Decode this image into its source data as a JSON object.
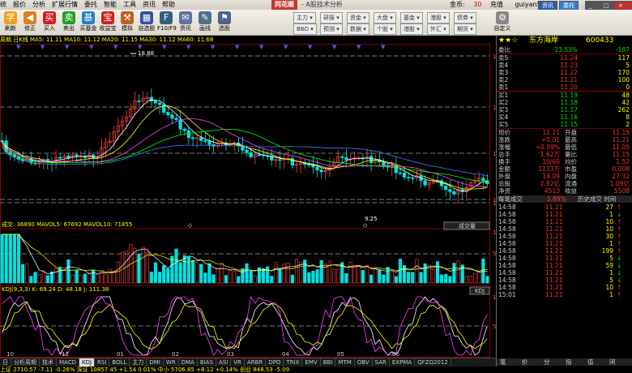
{
  "menu": {
    "items": [
      "统",
      "报价",
      "分析",
      "扩展行情",
      "委托",
      "智能",
      "工具",
      "资讯",
      "帮助"
    ],
    "brand": "同花顺",
    "subtitle": "- A股技术分析",
    "coins_label": "金币:",
    "coins_value": "30",
    "recharge": "充值",
    "user": "guiyan522",
    "btn_news": "资讯",
    "btn_trade": "委托"
  },
  "toolbar": {
    "buttons": [
      {
        "label": "刷新",
        "icon": "refresh-icon",
        "glyph": "学",
        "color": "#f0a020"
      },
      {
        "label": "修正",
        "icon": "back-icon",
        "glyph": "◀",
        "color": "#e08020"
      },
      {
        "label": "买入",
        "icon": "buy-icon",
        "glyph": "买",
        "color": "#d02020"
      },
      {
        "label": "卖出",
        "icon": "sell-icon",
        "glyph": "卖",
        "color": "#20a020"
      },
      {
        "label": "买基金",
        "icon": "fund-icon",
        "glyph": "基",
        "color": "#2080d0"
      },
      {
        "label": "收益宝",
        "icon": "profit-icon",
        "glyph": "宝",
        "color": "#d02020"
      },
      {
        "label": "模拟",
        "icon": "hammer-icon",
        "glyph": "⚒",
        "color": "#c06020"
      },
      {
        "label": "自选股",
        "icon": "watchlist-icon",
        "glyph": "▦",
        "color": "#3050a0"
      },
      {
        "label": "F10/F9",
        "icon": "f10-icon",
        "glyph": "F",
        "color": "#306080"
      },
      {
        "label": "资讯",
        "icon": "news-icon",
        "glyph": "✉",
        "color": "#6070a0"
      },
      {
        "label": "画线",
        "icon": "draw-icon",
        "glyph": "✎",
        "color": "#507090"
      },
      {
        "label": "选股",
        "icon": "stockpick-icon",
        "glyph": "⚑",
        "color": "#506090"
      }
    ],
    "pills": [
      {
        "label": "主力",
        "sub": "BBD"
      },
      {
        "label": "研报",
        "sub": "预测"
      },
      {
        "label": "资金",
        "sub": "数据"
      },
      {
        "label": "大盘",
        "sub": "个股"
      },
      {
        "label": "基金",
        "sub": "港股"
      },
      {
        "label": "港股",
        "sub": "外汇"
      },
      {
        "label": "债券",
        "sub": "期货"
      }
    ],
    "custom_label": "自定义"
  },
  "chart": {
    "info_line": "周期  日K线  MA5: 11.11  MA10: 11.12  MA20: 11.15  MA30: 11.12  MA60: 11.68",
    "vol_info": "成交: 36890  MAVOL5: 67692  MAVOL10: 71855",
    "kdj_info": "KDJ(9,3,3)  K: 69.24  D: 48.18  J: 111.38",
    "right_axis": [
      "18.88",
      "17.70",
      "14.62",
      "12.24",
      "10.75"
    ],
    "vol_axis": [
      "113990",
      "57634",
      "0"
    ],
    "kdj_axis": [
      "100.00",
      "50.00",
      "0.00"
    ],
    "high_label": "18.88",
    "low_label": "9.25",
    "vol_btn": "成交量",
    "kdj_btn": "KDJ",
    "x_ticks": [
      "10",
      "12",
      "01",
      "02",
      "03",
      "04",
      "05",
      "06"
    ]
  },
  "tabs": {
    "items": [
      "日",
      "分析周期",
      "技术",
      "MACD",
      "KDJ",
      "RSI",
      "BOLL",
      "主力",
      "DMI",
      "WR",
      "DMA",
      "BIAS",
      "ASI",
      "VR",
      "ARBR",
      "DPO",
      "TRIX",
      "EMV",
      "BBI",
      "MTM",
      "OBV",
      "SAR",
      "EXPMA",
      "QFZQ2012"
    ],
    "active_index": 4
  },
  "status": "上证 2710.57  -7.11  -0.26%   深证 10857.45  +1.54  0.01%   中小 5706.85  +8.12  +0.14%   创业 848.53  -5.09",
  "quote": {
    "rating": "★★☆",
    "name": "东方海岸",
    "code": "600433",
    "weibi_label": "委比",
    "weibi": "-23.53%",
    "weicha_label": "委差",
    "weicha": "-187",
    "sell": [
      {
        "lvl": "5",
        "price": "11.24",
        "vol": "117"
      },
      {
        "lvl": "4",
        "price": "11.23",
        "vol": "5"
      },
      {
        "lvl": "3",
        "price": "11.22",
        "vol": "170"
      },
      {
        "lvl": "2",
        "price": "11.21",
        "vol": "100"
      },
      {
        "lvl": "1",
        "price": "11.20",
        "vol": "0"
      }
    ],
    "buy": [
      {
        "lvl": "1",
        "price": "11.19",
        "vol": "48"
      },
      {
        "lvl": "2",
        "price": "11.18",
        "vol": "42"
      },
      {
        "lvl": "3",
        "price": "11.17",
        "vol": "262"
      },
      {
        "lvl": "4",
        "price": "11.16",
        "vol": "8"
      },
      {
        "lvl": "5",
        "price": "11.15",
        "vol": "2"
      }
    ],
    "stats": [
      {
        "k": "现价",
        "v": "11.21",
        "k2": "开盘",
        "v2": "11.15"
      },
      {
        "k": "涨跌",
        "v": "+0.01",
        "k2": "最高",
        "v2": "11.21"
      },
      {
        "k": "涨幅",
        "v": "+0.09%",
        "k2": "最低",
        "v2": "11.05"
      },
      {
        "k": "总手",
        "v": "1.62万",
        "k2": "量比",
        "v2": "11.15"
      },
      {
        "k": "换手",
        "v": "10/60",
        "k2": "均价",
        "v2": "1.52"
      },
      {
        "k": "金额",
        "v": "1133万",
        "k2": "市盈",
        "v2": "0.008"
      },
      {
        "k": "外盘",
        "v": "14.09",
        "k2": "内盘",
        "v2": "27.32"
      },
      {
        "k": "总股",
        "v": "2.92亿",
        "k2": "流通",
        "v2": "1.09亿"
      },
      {
        "k": "净资",
        "v": "4513",
        "k2": "收益",
        "v2": "5508"
      }
    ],
    "trades_header_left": "每笔成交",
    "trades_header_mid": "5.89%",
    "trades_header_right": "历史成交 时间",
    "trades": [
      {
        "t": "14:58",
        "p": "11.21",
        "v": "27",
        "d": "up"
      },
      {
        "t": "14:58",
        "p": "11.21",
        "v": "1",
        "d": "dn"
      },
      {
        "t": "14:58",
        "p": "11.21",
        "v": "10",
        "d": "up"
      },
      {
        "t": "14:58",
        "p": "11.21",
        "v": "10",
        "d": "up"
      },
      {
        "t": "14:58",
        "p": "11.21",
        "v": "30",
        "d": "up"
      },
      {
        "t": "14:58",
        "p": "11.21",
        "v": "1",
        "d": "up"
      },
      {
        "t": "14:58",
        "p": "11.21",
        "v": "199",
        "d": "up"
      },
      {
        "t": "14:58",
        "p": "11.21",
        "v": "5",
        "d": "dn"
      },
      {
        "t": "14:58",
        "p": "11.21",
        "v": "59",
        "d": "dn"
      },
      {
        "t": "14:58",
        "p": "11.21",
        "v": "1",
        "d": "dn"
      },
      {
        "t": "14:58",
        "p": "11.21",
        "v": "5",
        "d": "dn"
      },
      {
        "t": "14:58",
        "p": "11.21",
        "v": "10",
        "d": "up"
      },
      {
        "t": "15:01",
        "p": "11.21",
        "v": "1",
        "d": "up"
      }
    ],
    "bottom_tabs": [
      "笔",
      "价",
      "分",
      "指",
      "值",
      "闭"
    ]
  }
}
